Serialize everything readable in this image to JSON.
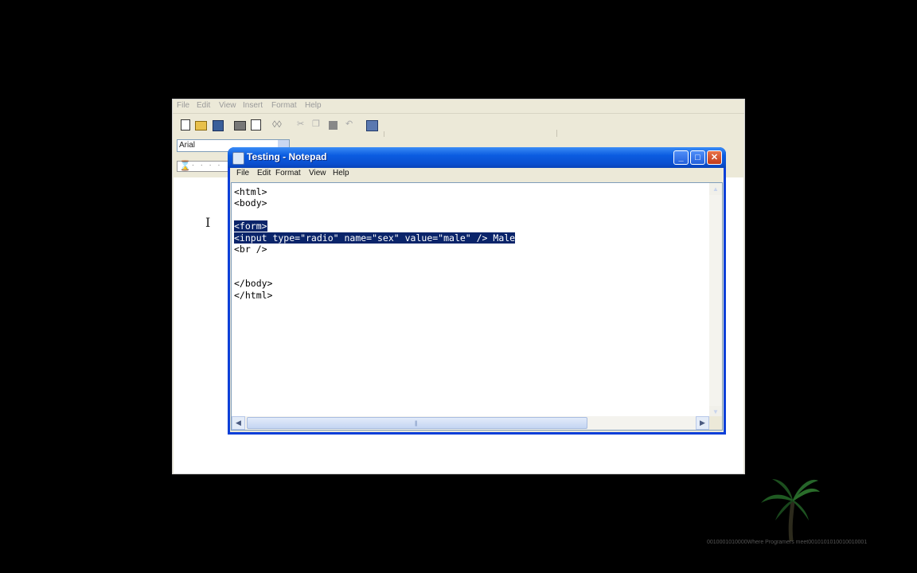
{
  "wordpad": {
    "menu": [
      "File",
      "Edit",
      "View",
      "Insert",
      "Format",
      "Help"
    ],
    "font": "Arial",
    "ruler_text": "· · · ·",
    "cursor_glyph": "I"
  },
  "notepad": {
    "title": "Testing - Notepad",
    "menu": [
      "File",
      "Edit",
      "Format",
      "View",
      "Help"
    ],
    "lines": [
      "<html>",
      "<body>",
      "",
      "<form>",
      "<input type=\"radio\" name=\"sex\" value=\"male\" /> Male",
      "<br />",
      "",
      "",
      "</body>",
      "</html>"
    ],
    "selected_lines": [
      3,
      4
    ],
    "caption": {
      "minimize": "_",
      "maximize": "□",
      "close": "✕"
    }
  },
  "watermark": {
    "text": "0010001010000Where Programers meet0010101010010010001"
  },
  "colors": {
    "xp_title_blue": "#0a4fd0",
    "selection": "#0a246a",
    "close_red": "#c13a1a"
  }
}
